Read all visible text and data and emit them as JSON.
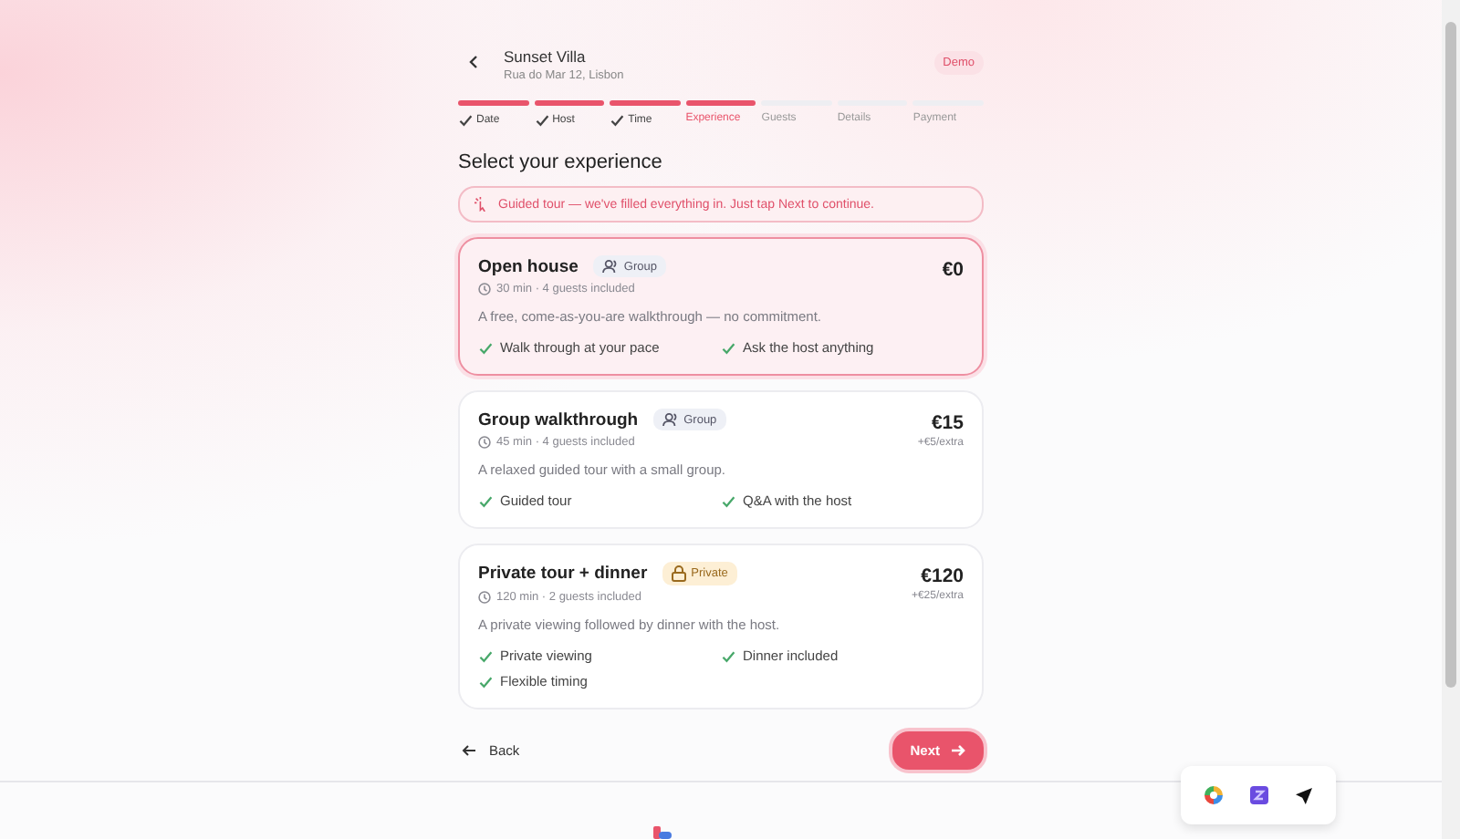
{
  "header": {
    "title": "Sunset Villa",
    "address": "Rua do Mar 12, Lisbon",
    "badge": "Demo"
  },
  "steps": [
    {
      "label": "Date",
      "completed": true,
      "selected": false
    },
    {
      "label": "Host",
      "completed": true,
      "selected": false
    },
    {
      "label": "Time",
      "completed": true,
      "selected": false
    },
    {
      "label": "Experience",
      "completed": false,
      "selected": true
    },
    {
      "label": "Guests",
      "completed": false,
      "selected": false
    },
    {
      "label": "Details",
      "completed": false,
      "selected": false
    },
    {
      "label": "Payment",
      "completed": false,
      "selected": false
    }
  ],
  "heading": "Select your experience",
  "banner": "Guided tour — we've filled everything in. Just tap Next to continue.",
  "options": [
    {
      "title": "Open house",
      "tag": {
        "label": "Group",
        "kind": "group"
      },
      "meta": "30 min · 4 guests included",
      "price": "€0",
      "description": "A free, come-as-you-are walkthrough — no commitment.",
      "features": [
        "Walk through at your pace",
        "Ask the host anything"
      ],
      "selected": true
    },
    {
      "title": "Group walkthrough",
      "tag": {
        "label": "Group",
        "kind": "group"
      },
      "meta": "45 min · 4 guests included",
      "price": "€15",
      "extra": "+€5/extra",
      "description": "A relaxed guided tour with a small group.",
      "features": [
        "Guided tour",
        "Q&A with the host"
      ],
      "selected": false
    },
    {
      "title": "Private tour + dinner",
      "tag": {
        "label": "Private",
        "kind": "private"
      },
      "meta": "120 min · 2 guests included",
      "price": "€120",
      "extra": "+€25/extra",
      "description": "A private viewing followed by dinner with the host.",
      "features": [
        "Private viewing",
        "Dinner included",
        "Flexible timing"
      ],
      "selected": false
    }
  ],
  "nav": {
    "back": "Back",
    "next": "Next"
  }
}
